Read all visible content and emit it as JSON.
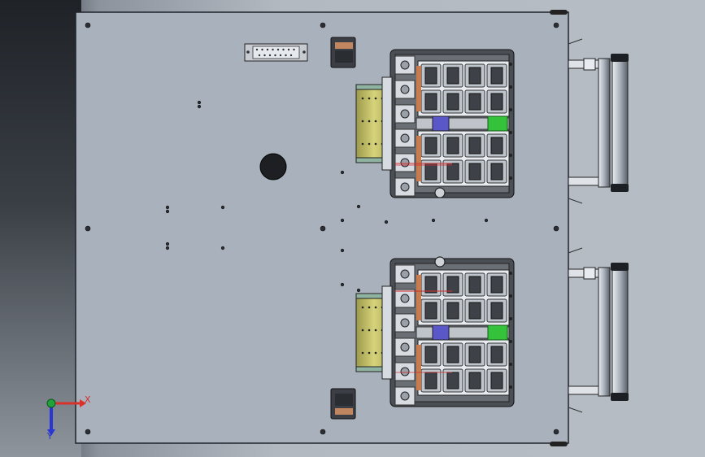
{
  "app": {
    "view": "top"
  },
  "triad": {
    "x_label": "X",
    "y_label": "Y",
    "colors": {
      "x": "#d8322a",
      "y": "#2a35d6",
      "z": "#1fa33a"
    }
  },
  "model_colors": {
    "plate": "#a9b1bc",
    "plate_edge": "#1f232a",
    "cylinder": "#c8c56a",
    "fixture": "#d8dce2",
    "tray": "#4a4e55",
    "accent_green": "#34c23a",
    "accent_blue": "#5a57c8",
    "accent_red": "#d22d2d"
  }
}
